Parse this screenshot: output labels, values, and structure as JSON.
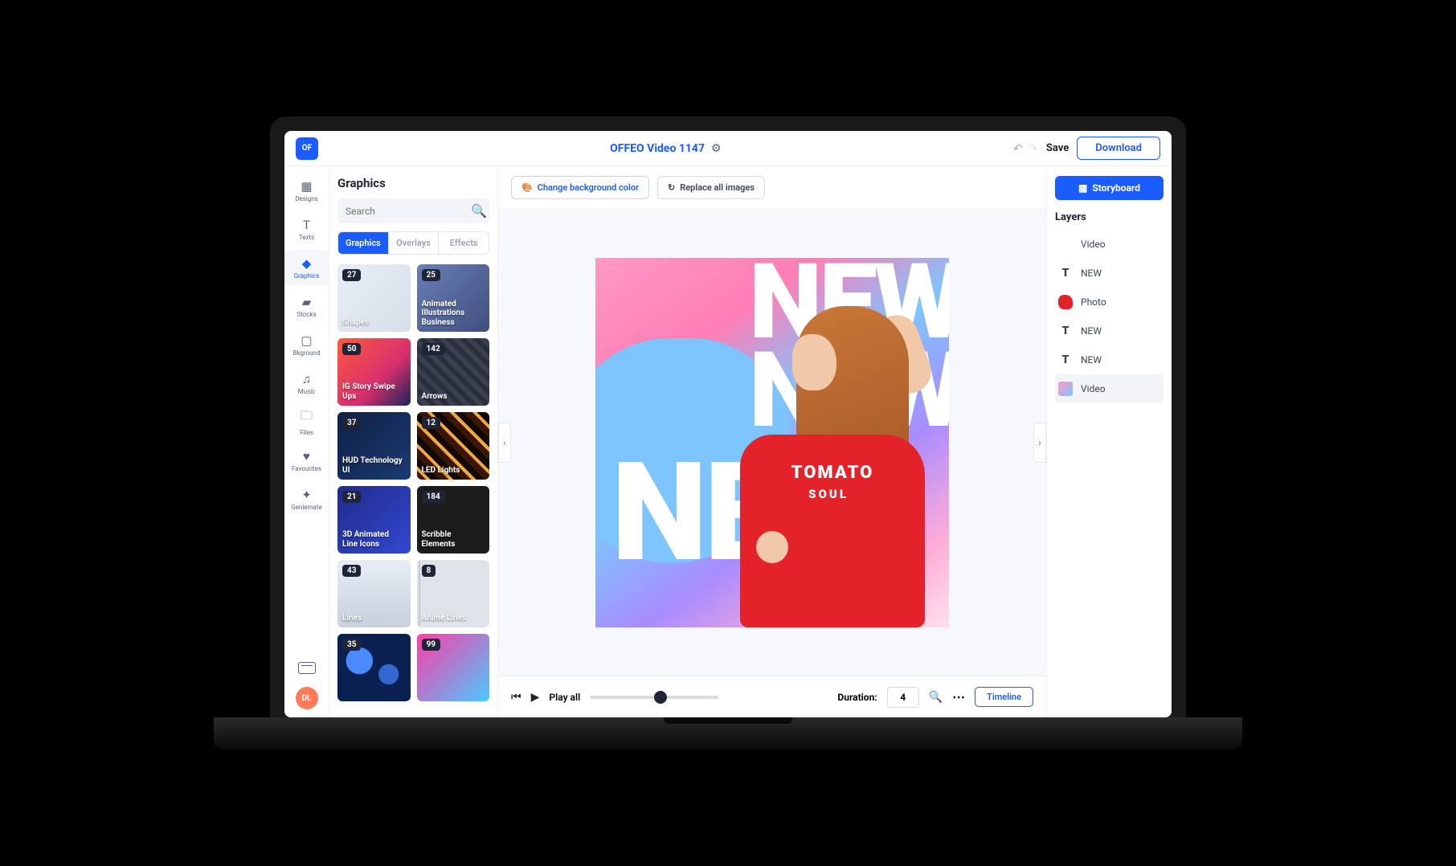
{
  "header": {
    "project_title": "OFFEO Video 1147",
    "save": "Save",
    "download": "Download"
  },
  "rail": [
    {
      "label": "Designs",
      "icon": "▦"
    },
    {
      "label": "Texts",
      "icon": "T"
    },
    {
      "label": "Graphics",
      "icon": "◆",
      "active": true
    },
    {
      "label": "Stocks",
      "icon": "▰"
    },
    {
      "label": "Bkground",
      "icon": "▢"
    },
    {
      "label": "Music",
      "icon": "♫"
    },
    {
      "label": "Files",
      "icon": "🗀"
    },
    {
      "label": "Favourites",
      "icon": "♥"
    },
    {
      "label": "Geniemate",
      "icon": "✦"
    }
  ],
  "avatar": "DL",
  "panel": {
    "title": "Graphics",
    "search_placeholder": "Search",
    "tabs": [
      "Graphics",
      "Overlays",
      "Effects"
    ]
  },
  "cards": [
    {
      "count": "27",
      "label": "Shapes",
      "bg": "bg-shapes"
    },
    {
      "count": "25",
      "label": "Animated Illustrations Business",
      "bg": "bg-illus"
    },
    {
      "count": "50",
      "label": "IG Story Swipe Ups",
      "bg": "bg-swipe"
    },
    {
      "count": "142",
      "label": "Arrows",
      "bg": "bg-arrows"
    },
    {
      "count": "37",
      "label": "HUD Technology UI",
      "bg": "bg-hud"
    },
    {
      "count": "12",
      "label": "LED Lights",
      "bg": "bg-led"
    },
    {
      "count": "21",
      "label": "3D Animated Line Icons",
      "bg": "bg-3d"
    },
    {
      "count": "184",
      "label": "Scribble Elements",
      "bg": "bg-scribble"
    },
    {
      "count": "43",
      "label": "Lines",
      "bg": "bg-lines"
    },
    {
      "count": "8",
      "label": "Anime Lines",
      "bg": "bg-anime"
    },
    {
      "count": "35",
      "label": "",
      "bg": "bg-bokeh"
    },
    {
      "count": "99",
      "label": "",
      "bg": "bg-glitch"
    }
  ],
  "toolbar": {
    "change_bg": "Change background color",
    "replace": "Replace all images"
  },
  "canvas": {
    "text": "NEW",
    "shirt_text": "TOMATO",
    "shirt_sub": "SOUL"
  },
  "playback": {
    "play_all": "Play all",
    "duration_label": "Duration:",
    "duration_value": "4",
    "timeline": "Timeline"
  },
  "right": {
    "storyboard": "Storyboard",
    "layers_title": "Layers",
    "layers": [
      {
        "name": "Video",
        "type": "video-empty"
      },
      {
        "name": "NEW",
        "type": "text"
      },
      {
        "name": "Photo",
        "type": "photo"
      },
      {
        "name": "NEW",
        "type": "text"
      },
      {
        "name": "NEW",
        "type": "text"
      },
      {
        "name": "Video",
        "type": "video",
        "selected": true
      }
    ]
  }
}
